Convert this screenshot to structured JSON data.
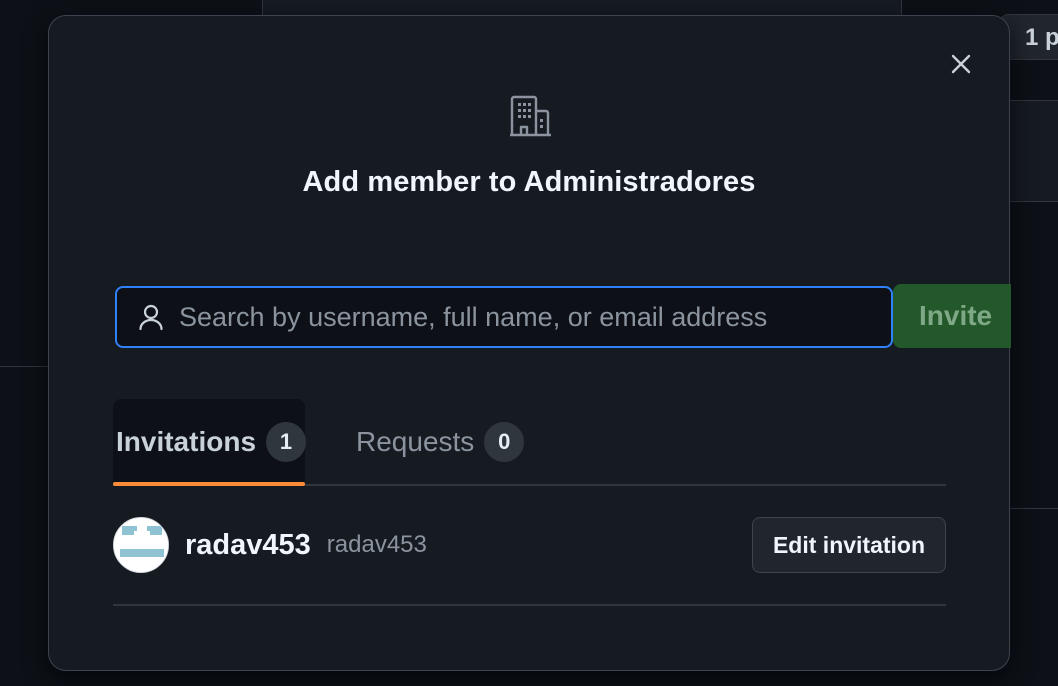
{
  "background": {
    "right_pill_text": "1 p"
  },
  "dialog": {
    "title": "Add member to Administradores",
    "close_icon": "x-icon",
    "header_icon": "organization-icon",
    "search": {
      "placeholder": "Search by username, full name, or email address",
      "value": "",
      "icon": "person-icon"
    },
    "invite_label": "Invite",
    "tabs": [
      {
        "label": "Invitations",
        "count": "1",
        "active": true
      },
      {
        "label": "Requests",
        "count": "0",
        "active": false
      }
    ],
    "members": [
      {
        "username": "radav453",
        "login": "radav453",
        "action_label": "Edit invitation"
      }
    ]
  },
  "colors": {
    "focus_border": "#2f81f7",
    "invite_bg": "#23592a",
    "active_tab_underline": "#fd8c3a"
  }
}
